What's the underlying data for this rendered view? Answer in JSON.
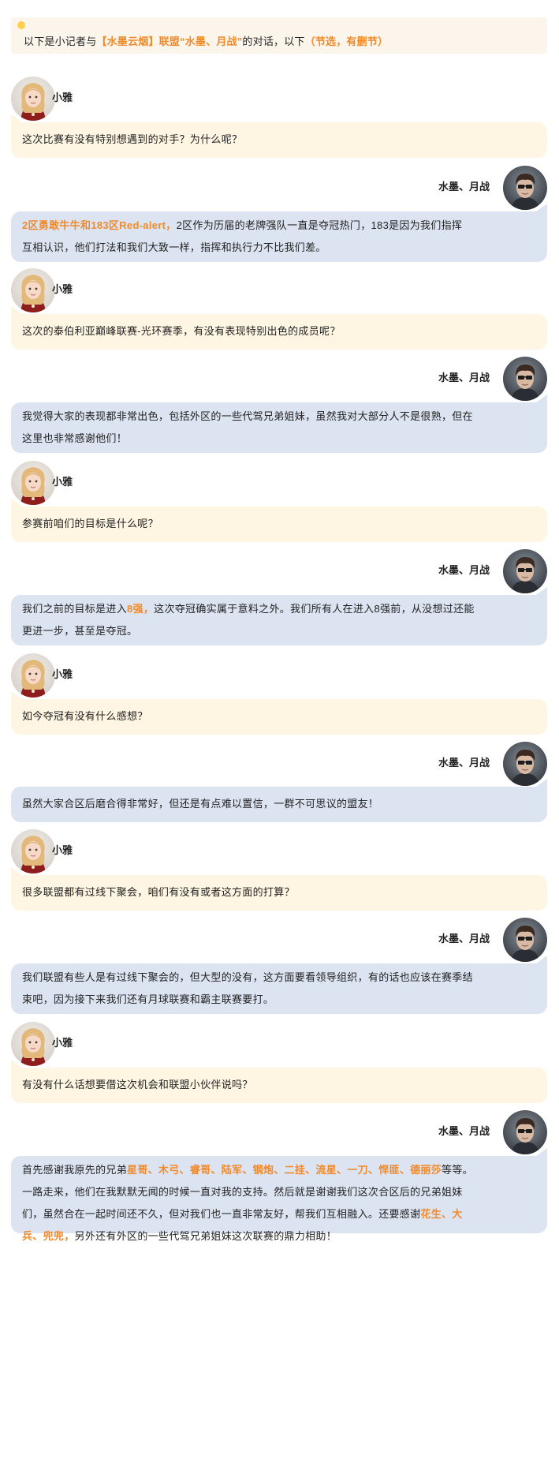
{
  "intro": {
    "prefix": "以下是小记者与",
    "alliance": "【水墨云烟】联盟",
    "player": "“水墨、月战”",
    "mid": "的对话，以下",
    "note": "（节选，有删节）"
  },
  "interviewer": {
    "name": "小雅",
    "avatar": "girl-avatar"
  },
  "player": {
    "name": "水墨、月战",
    "avatar": "boy-avatar"
  },
  "dialogue": [
    {
      "q": "这次比赛有没有特别想遇到的对手？为什么呢？",
      "a_hl": "2区勇敢牛牛和183区Red-alert，",
      "a_line1": "2区作为历届的老牌强队一直是夺冠热门，183是因为我们指挥",
      "a_line2": "互相认识，他们打法和我们大致一样，指挥和执行力不比我们差。"
    },
    {
      "q": "这次的泰伯利亚巅峰联赛-光环赛季，有没有表现特别出色的成员呢？",
      "a_line1": "我觉得大家的表现都非常出色，包括外区的一些代驾兄弟姐妹，虽然我对大部分人不是很熟，但在",
      "a_line2": "这里也非常感谢他们！"
    },
    {
      "q": "参赛前咱们的目标是什么呢？",
      "a_pre": "我们之前的目标是进入",
      "a_hl": "8强，",
      "a_line1": "这次夺冠确实属于意料之外。我们所有人在进入8强前，从没想过还能",
      "a_line2": "更进一步，甚至是夺冠。"
    },
    {
      "q": "如今夺冠有没有什么感想？",
      "a_line1": "虽然大家合区后磨合得非常好，但还是有点难以置信，一群不可思议的盟友！"
    },
    {
      "q": "很多联盟都有过线下聚会，咱们有没有或者这方面的打算？",
      "a_line1": "我们联盟有些人是有过线下聚会的，但大型的没有，这方面要看领导组织，有的话也应该在赛季结",
      "a_line2": "束吧，因为接下来我们还有月球联赛和霸主联赛要打。"
    },
    {
      "q": "有没有什么话想要借这次机会和联盟小伙伴说吗？",
      "a_p1": "首先感谢我原先的兄弟",
      "a_names": "星哥、木弓、睿哥、陆军、钢炮、二挂、流星、一刀、悍匪、德丽莎",
      "a_p2": "等等。",
      "a_line2": "一路走来，他们在我默默无闻的时候一直对我的支持。然后就是谢谢我们这次合区后的兄弟姐妹",
      "a_line3a": "们，虽然合在一起时间还不久，但对我们也一直非常友好，帮我们互相融入。还要感谢",
      "a_line3hl": "花生、大",
      "a_line4hl": "兵、兜兜，",
      "a_line4": "另外还有外区的一些代驾兄弟姐妹这次联赛的鼎力相助！"
    }
  ]
}
